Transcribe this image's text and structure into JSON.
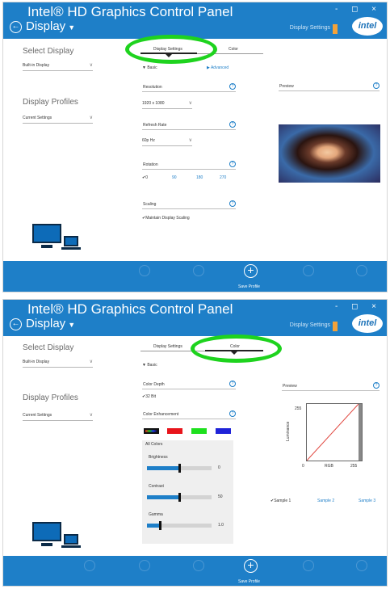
{
  "app_title": "Intel® HD Graphics Control Panel",
  "section": "Display",
  "window_controls": "- ◻ ×",
  "logo": "intel",
  "top": {
    "breadcrumb": "Display Settings",
    "left": {
      "select_display_label": "Select Display",
      "select_display_value": "Built-in Display",
      "profiles_label": "Display Profiles",
      "profiles_value": "Current Settings"
    },
    "tabs": [
      "Display Settings",
      "Color"
    ],
    "basic": "▼ Basic",
    "advanced": "▶ Advanced",
    "resolution": {
      "label": "Resolution",
      "value": "1920 x 1080"
    },
    "refresh": {
      "label": "Refresh Rate",
      "value": "60p Hz"
    },
    "rotation": {
      "label": "Rotation",
      "options": [
        "✔0",
        "90",
        "180",
        "270"
      ]
    },
    "scaling": {
      "label": "Scaling",
      "option": "✔Maintain Display Scaling"
    },
    "preview": "Preview",
    "save_profile": "Save Profile"
  },
  "bottom": {
    "breadcrumb": "Display Settings",
    "left": {
      "select_display_label": "Select Display",
      "select_display_value": "Built-in Display",
      "profiles_label": "Display Profiles",
      "profiles_value": "Current Settings"
    },
    "tabs": [
      "Display Settings",
      "Color"
    ],
    "basic": "▼ Basic",
    "color_depth": {
      "label": "Color Depth",
      "value": "✔32 Bit"
    },
    "color_enhancement": "Color Enhancement",
    "all_colors": "All Colors",
    "brightness": {
      "label": "Brightness",
      "value": "0",
      "level": 0.5
    },
    "contrast": {
      "label": "Contrast",
      "value": "50",
      "level": 0.5
    },
    "gamma": {
      "label": "Gamma",
      "value": "1.0",
      "level": 0.2
    },
    "preview": "Preview",
    "graph": {
      "y_max": "255",
      "y_label": "Luminance",
      "x_min": "0",
      "x_label": "RGB",
      "x_max": "255"
    },
    "samples": [
      "✔Sample 1",
      "Sample 2",
      "Sample 3"
    ],
    "save_profile": "Save Profile"
  }
}
